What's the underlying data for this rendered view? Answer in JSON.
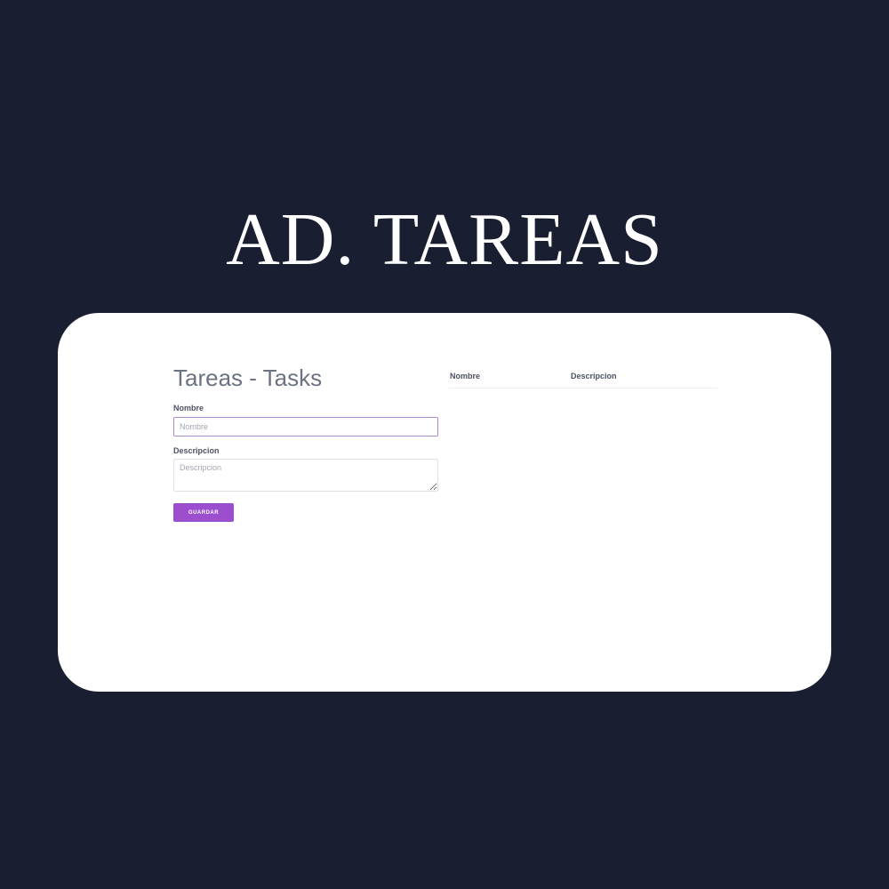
{
  "banner": {
    "title": "AD. TAREAS"
  },
  "app": {
    "title": "Tareas - Tasks"
  },
  "form": {
    "name_label": "Nombre",
    "name_placeholder": "Nombre",
    "name_value": "",
    "description_label": "Descripcion",
    "description_placeholder": "Descripcion",
    "description_value": "",
    "save_label": "GUARDAR"
  },
  "table": {
    "columns": [
      "Nombre",
      "Descripcion"
    ],
    "rows": []
  },
  "colors": {
    "background": "#1a1e31",
    "accent": "#9b4fcf",
    "card": "#ffffff"
  }
}
